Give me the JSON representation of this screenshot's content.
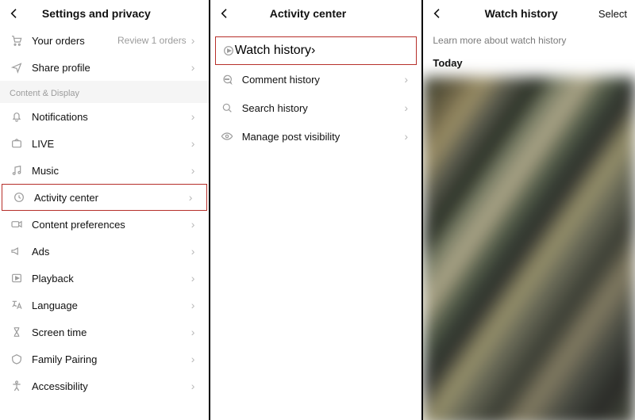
{
  "pane1": {
    "title": "Settings and privacy",
    "top_rows": [
      {
        "icon": "orders",
        "label": "Your orders",
        "aux": "Review 1 orders"
      },
      {
        "icon": "share",
        "label": "Share profile"
      }
    ],
    "section_label": "Content & Display",
    "rows": [
      {
        "icon": "bell",
        "label": "Notifications"
      },
      {
        "icon": "live",
        "label": "LIVE"
      },
      {
        "icon": "music",
        "label": "Music"
      },
      {
        "icon": "clock",
        "label": "Activity center",
        "highlight": true
      },
      {
        "icon": "video",
        "label": "Content preferences"
      },
      {
        "icon": "ads",
        "label": "Ads"
      },
      {
        "icon": "play",
        "label": "Playback"
      },
      {
        "icon": "lang",
        "label": "Language"
      },
      {
        "icon": "hourglass",
        "label": "Screen time"
      },
      {
        "icon": "family",
        "label": "Family Pairing"
      },
      {
        "icon": "access",
        "label": "Accessibility"
      }
    ]
  },
  "pane2": {
    "title": "Activity center",
    "rows": [
      {
        "icon": "playcircle",
        "label": "Watch history",
        "highlight": true
      },
      {
        "icon": "comment",
        "label": "Comment history"
      },
      {
        "icon": "search",
        "label": "Search history"
      },
      {
        "icon": "eye",
        "label": "Manage post visibility"
      }
    ]
  },
  "pane3": {
    "title": "Watch history",
    "select_label": "Select",
    "learn_more": "Learn more about watch history",
    "today_label": "Today"
  }
}
